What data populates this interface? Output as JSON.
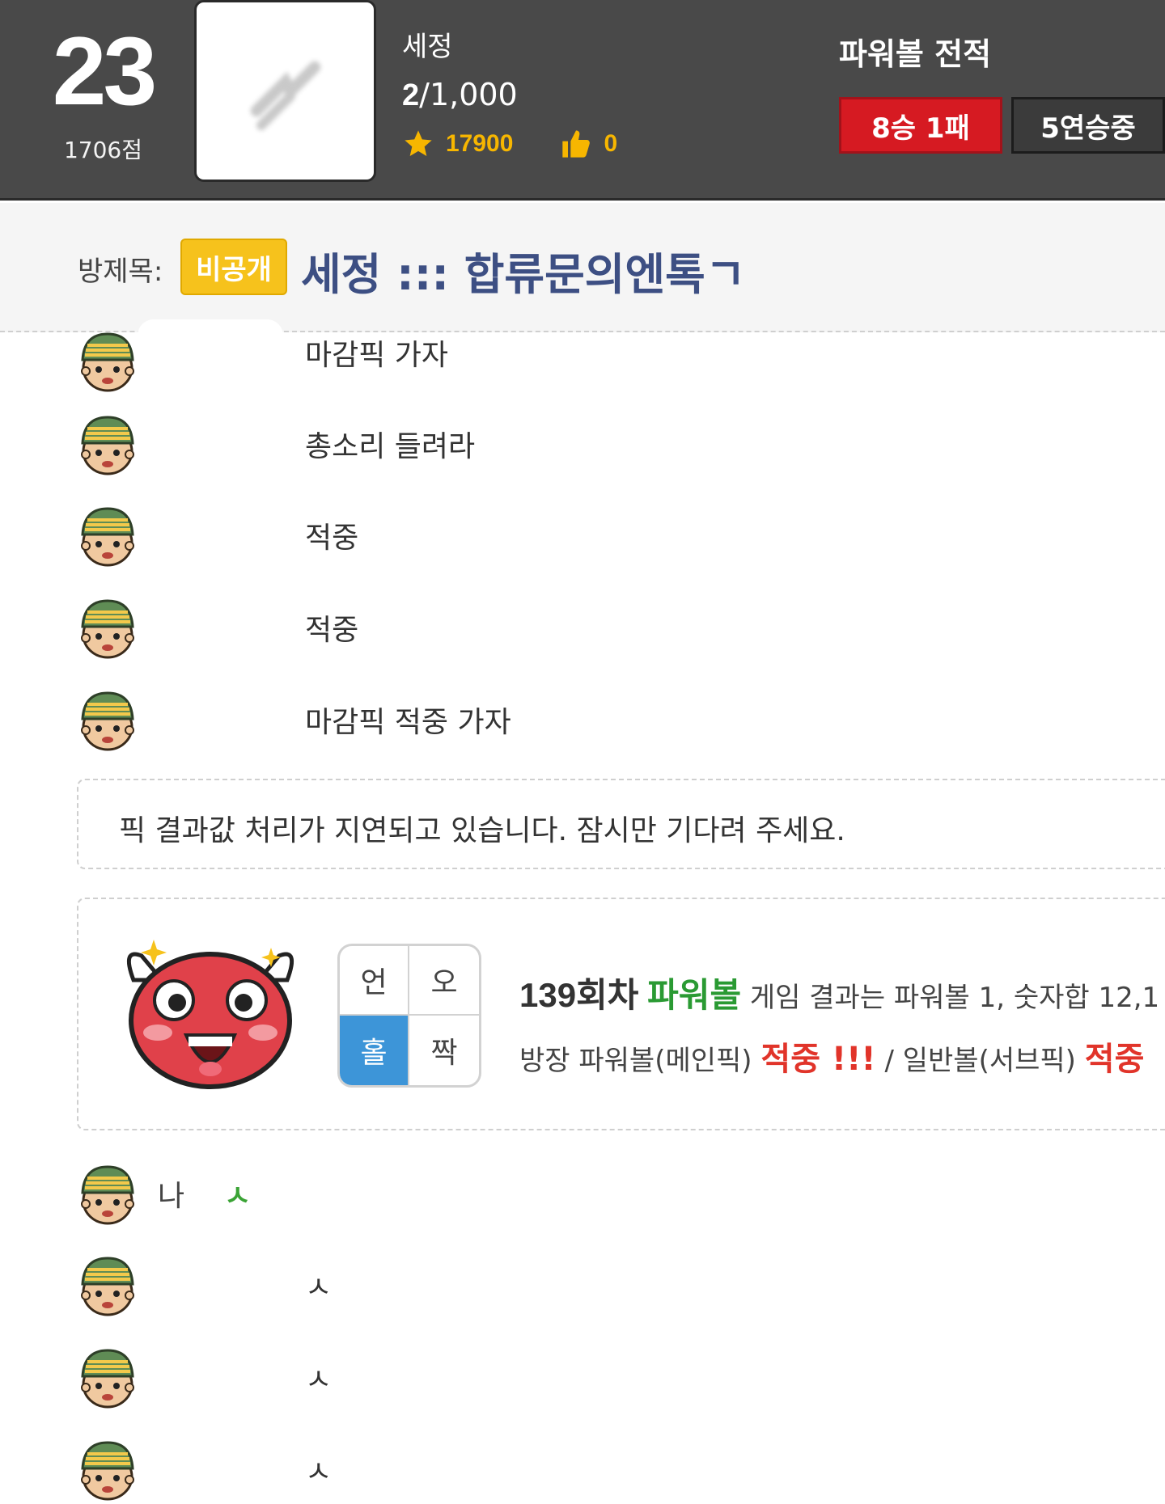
{
  "header": {
    "rank": "23",
    "points": "1706점",
    "user_name": "세정",
    "room_count_current": "2",
    "room_count_rest": "/1,000",
    "stars": "17900",
    "likes": "0",
    "record_title": "파워볼 전적",
    "record": "8승 1패",
    "streak": "5연승중",
    "colors": {
      "record_badge": "#d61a22",
      "star": "#f7b600"
    }
  },
  "room": {
    "title_label": "방제목:",
    "private_badge": "비공개",
    "title": "세정 ::: 합류문의엔톡ㄱ"
  },
  "chat": [
    {
      "message": "마감픽 가자"
    },
    {
      "message": "총소리 들려라"
    },
    {
      "message": "적중"
    },
    {
      "message": "적중"
    },
    {
      "message": "마감픽 적중 가자"
    }
  ],
  "notice": "픽 결과값 처리가 지연되고 있습니다. 잠시만 기다려 주세요.",
  "result": {
    "grid": [
      {
        "label": "언",
        "selected": false
      },
      {
        "label": "오",
        "selected": false
      },
      {
        "label": "홀",
        "selected": true
      },
      {
        "label": "짝",
        "selected": false
      }
    ],
    "round": "139회차",
    "game": "파워볼",
    "line1_text": "게임 결과는 파워볼 1, 숫자합 12,1",
    "line2_main_label": "방장 파워볼(메인픽)",
    "line2_main_hit": "적중 !!!",
    "line2_sep": "/ 일반볼(서브픽)",
    "line2_sub_hit": "적중"
  },
  "chat_after": [
    {
      "nick": "나",
      "message": "ㅅ"
    },
    {
      "message": "ㅅ"
    },
    {
      "message": "ㅅ"
    },
    {
      "message": "ㅅ"
    }
  ]
}
